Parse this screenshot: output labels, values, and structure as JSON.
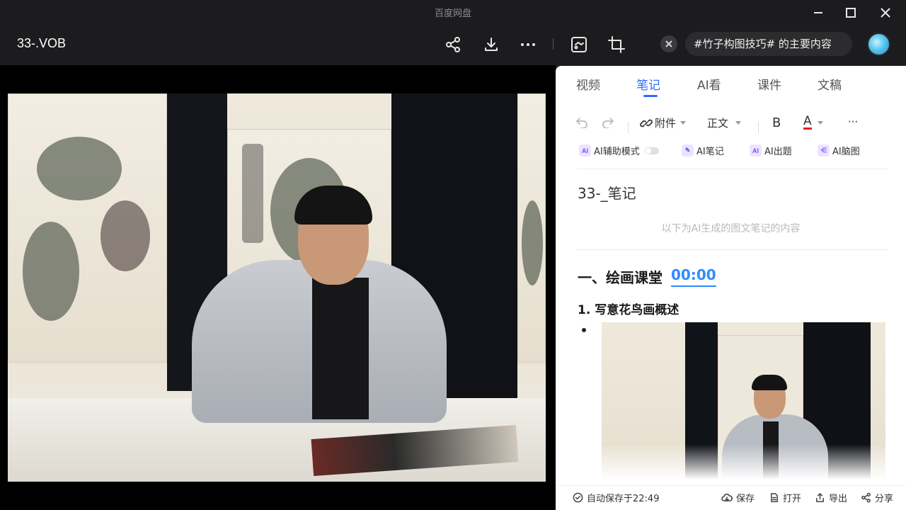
{
  "window": {
    "app_title": "百度网盘"
  },
  "toolbar": {
    "file_name": "33-.VOB",
    "search_query": "#竹子构图技巧# 的主要内容"
  },
  "icons": {
    "share": "share-icon",
    "download": "download-icon",
    "more": "more-icon",
    "screenshot": "screenshot-icon",
    "crop": "crop-icon",
    "close": "close-icon",
    "minimize": "minimize-icon",
    "maximize": "maximize-icon"
  },
  "colors": {
    "accent": "#2f6bff",
    "timestamp": "#2f8cff",
    "dark_bg": "#1c1c1e"
  },
  "panel": {
    "tabs": [
      {
        "label": "视频"
      },
      {
        "label": "笔记",
        "active": true
      },
      {
        "label": "AI看"
      },
      {
        "label": "课件"
      },
      {
        "label": "文稿"
      }
    ],
    "format_toolbar": {
      "attachment": "附件",
      "text_style": "正文",
      "bold": "B",
      "font_color": "A",
      "more": "···"
    },
    "ai_tools": {
      "assist_mode": "AI辅助模式",
      "ai_note": "AI笔记",
      "ai_quiz": "AI出题",
      "ai_mindmap": "AI脑图"
    },
    "note": {
      "title": "33-_笔记",
      "hint": "以下为AI生成的图文笔记的内容",
      "heading1": "一、绘画课堂",
      "timestamp": "00:00",
      "heading2": "1. 写意花鸟画概述"
    },
    "footer": {
      "autosave": "自动保存于22:49",
      "save": "保存",
      "open": "打开",
      "export": "导出",
      "share": "分享"
    }
  }
}
